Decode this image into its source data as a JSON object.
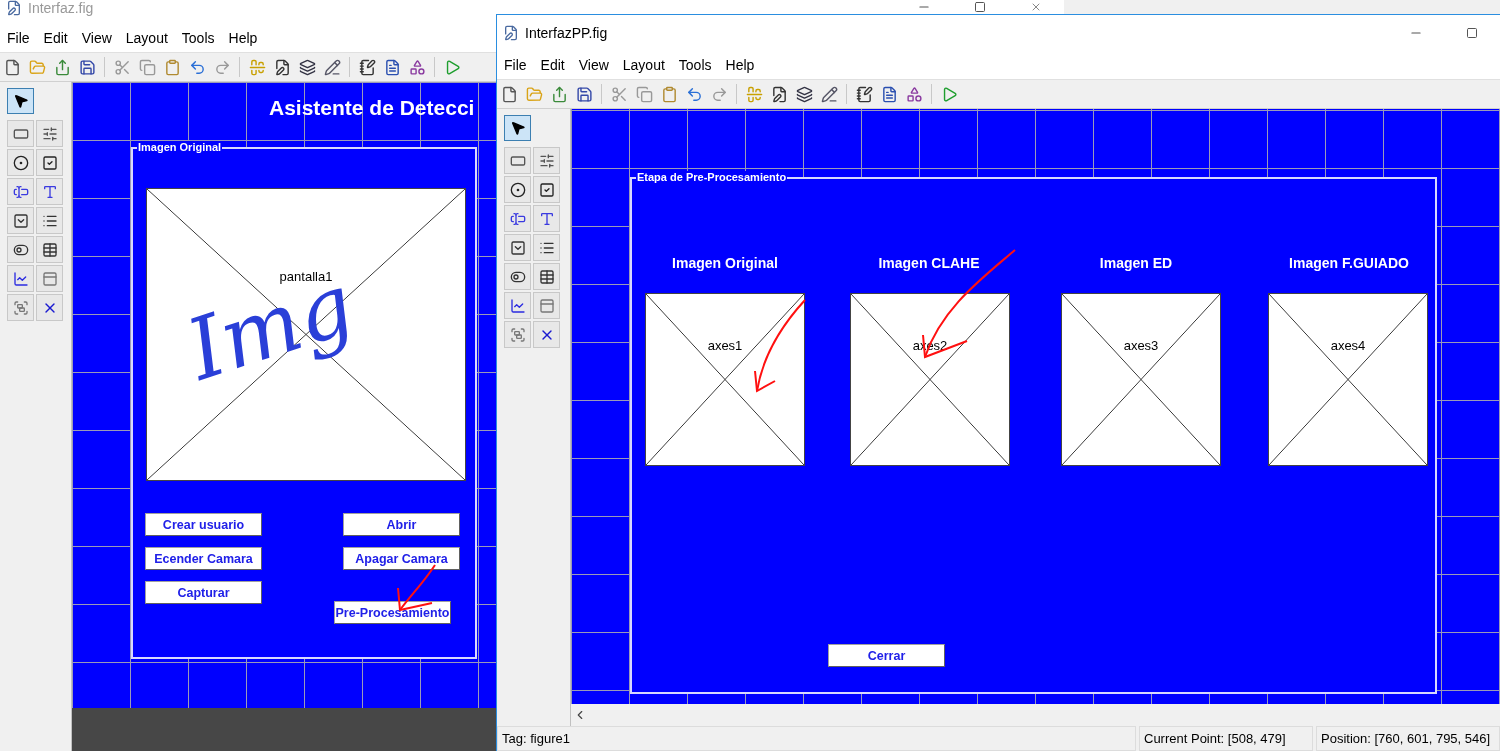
{
  "back_window": {
    "title": "Interfaz.fig",
    "active": false,
    "menu": [
      "File",
      "Edit",
      "View",
      "Layout",
      "Tools",
      "Help"
    ],
    "heading": "Asistente de Detecci",
    "panel": {
      "title": "Imagen Original",
      "axes_label": "pantalla1",
      "note": "Img"
    },
    "buttons": [
      "Crear usuario",
      "Abrir",
      "Ecender Camara",
      "Apagar Camara",
      "Capturar",
      "Pre-Procesamiento"
    ]
  },
  "front_window": {
    "title": "InterfazPP.fig",
    "active": true,
    "menu": [
      "File",
      "Edit",
      "View",
      "Layout",
      "Tools",
      "Help"
    ],
    "panel": {
      "title": "Etapa de Pre-Procesamiento",
      "columns": [
        {
          "heading": "Imagen Original",
          "axes_label": "axes1"
        },
        {
          "heading": "Imagen CLAHE",
          "axes_label": "axes2"
        },
        {
          "heading": "Imagen ED",
          "axes_label": "axes3"
        },
        {
          "heading": "Imagen F.GUIADO",
          "axes_label": "axes4"
        }
      ]
    },
    "button": "Cerrar",
    "status_bar": {
      "tag": "Tag: figure1",
      "current_point": "Current Point:  [508, 479]",
      "position": "Position: [760, 601, 795, 546]"
    }
  }
}
